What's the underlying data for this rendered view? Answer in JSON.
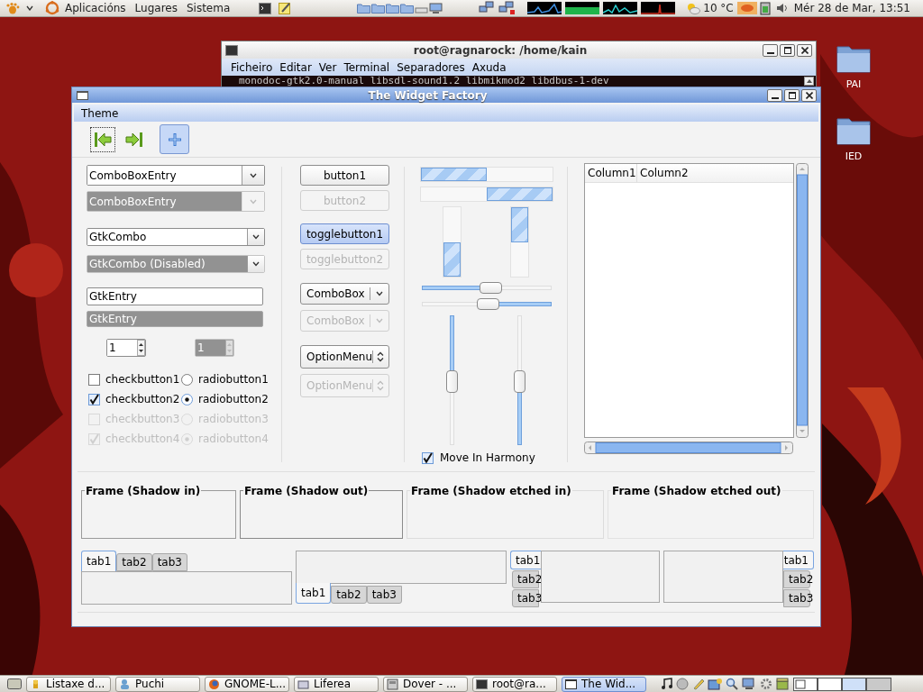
{
  "top_panel": {
    "menus": [
      "Aplicacións",
      "Lugares",
      "Sistema"
    ],
    "temperature": "10 °C",
    "clock": "Mér 28 de Mar, 13:51"
  },
  "desktop_icons": [
    {
      "label": "PAI"
    },
    {
      "label": "IED"
    }
  ],
  "terminal": {
    "title": "root@ragnarock: /home/kain",
    "menu": [
      "Ficheiro",
      "Editar",
      "Ver",
      "Terminal",
      "Separadores",
      "Axuda"
    ],
    "output": "monodoc-gtk2.0-manual libsdl-sound1.2 libmikmod2 libdbus-1-dev"
  },
  "widget_factory": {
    "title": "The Widget Factory",
    "menu": [
      "Theme"
    ],
    "toolbar": [
      {
        "focused": true,
        "selected": false
      },
      {
        "focused": false,
        "selected": false
      },
      {
        "focused": false,
        "selected": true
      }
    ],
    "combo_box_entries": [
      {
        "value": "ComboBoxEntry",
        "disabled": false
      },
      {
        "value": "ComboBoxEntry",
        "disabled": true
      }
    ],
    "gtk_combos": [
      {
        "value": "GtkCombo",
        "disabled": false
      },
      {
        "value": "GtkCombo (Disabled)",
        "disabled": true
      }
    ],
    "entries": [
      {
        "value": "GtkEntry",
        "disabled": false
      },
      {
        "value": "GtkEntry",
        "disabled": true
      }
    ],
    "spin_buttons": [
      {
        "value": "1",
        "disabled": false
      },
      {
        "value": "1",
        "disabled": true
      }
    ],
    "check_buttons": [
      {
        "label": "checkbutton1",
        "checked": false,
        "disabled": false
      },
      {
        "label": "checkbutton2",
        "checked": true,
        "disabled": false
      },
      {
        "label": "checkbutton3",
        "checked": false,
        "disabled": true
      },
      {
        "label": "checkbutton4",
        "checked": true,
        "disabled": true
      }
    ],
    "radio_buttons": [
      {
        "label": "radiobutton1",
        "selected": false,
        "disabled": false
      },
      {
        "label": "radiobutton2",
        "selected": true,
        "disabled": false
      },
      {
        "label": "radiobutton3",
        "selected": false,
        "disabled": true
      },
      {
        "label": "radiobutton4",
        "selected": true,
        "disabled": true
      }
    ],
    "buttons": [
      {
        "label": "button1",
        "disabled": false
      },
      {
        "label": "button2",
        "disabled": true
      }
    ],
    "toggle_buttons": [
      {
        "label": "togglebutton1",
        "selected": true,
        "disabled": false
      },
      {
        "label": "togglebutton2",
        "selected": false,
        "disabled": true
      }
    ],
    "combo_boxes": [
      {
        "value": "ComboBox",
        "disabled": false
      },
      {
        "value": "ComboBox",
        "disabled": true
      }
    ],
    "option_menus": [
      {
        "value": "OptionMenu",
        "disabled": false
      },
      {
        "value": "OptionMenu",
        "disabled": true
      }
    ],
    "progress_bars": [
      {
        "kind": "horizontal",
        "inverted": false,
        "level": 0.5
      },
      {
        "kind": "horizontal",
        "inverted": true,
        "level": 0.5
      },
      {
        "kind": "vertical",
        "inverted": false,
        "level": 0.5
      },
      {
        "kind": "vertical",
        "inverted": true,
        "level": 0.5
      }
    ],
    "scales": [
      {
        "kind": "horizontal",
        "inverted": false,
        "level": 0.53
      },
      {
        "kind": "horizontal",
        "inverted": true,
        "level": 0.5
      },
      {
        "kind": "vertical",
        "inverted": false,
        "level": 0.5
      },
      {
        "kind": "vertical",
        "inverted": true,
        "level": 0.5
      }
    ],
    "harmony_check": {
      "label": "Move In Harmony",
      "checked": true
    },
    "tree": {
      "columns": [
        "Column1",
        "Column2"
      ]
    },
    "frames": [
      {
        "label": "Frame (Shadow in)",
        "kind": "in"
      },
      {
        "label": "Frame (Shadow out)",
        "kind": "out"
      },
      {
        "label": "Frame (Shadow etched in)",
        "kind": "etched_in"
      },
      {
        "label": "Frame (Shadow etched out)",
        "kind": "etched_out"
      }
    ],
    "notebooks": [
      {
        "kind": "top",
        "tabs": [
          {
            "label": "tab1",
            "selected": true
          },
          {
            "label": "tab2",
            "selected": false
          },
          {
            "label": "tab3",
            "selected": false
          }
        ]
      },
      {
        "kind": "bottom",
        "tabs": [
          {
            "label": "tab1",
            "selected": true
          },
          {
            "label": "tab2",
            "selected": false
          },
          {
            "label": "tab3",
            "selected": false
          }
        ]
      },
      {
        "kind": "left",
        "tabs": [
          {
            "label": "tab1",
            "selected": true
          },
          {
            "label": "tab2",
            "selected": false
          },
          {
            "label": "tab3",
            "selected": false
          }
        ]
      },
      {
        "kind": "right",
        "tabs": [
          {
            "label": "tab1",
            "selected": true
          },
          {
            "label": "tab2",
            "selected": false
          },
          {
            "label": "tab3",
            "selected": false
          }
        ]
      }
    ]
  },
  "taskbar": {
    "tasks": [
      {
        "label": "Listaxe d...",
        "selected": false
      },
      {
        "label": "Puchi",
        "selected": false
      },
      {
        "label": "GNOME-L...",
        "selected": false
      },
      {
        "label": "Liferea",
        "selected": false
      },
      {
        "label": "Dover - ...",
        "selected": false
      },
      {
        "label": "root@ra...",
        "selected": false
      },
      {
        "label": "The Wid...",
        "selected": true
      }
    ]
  }
}
